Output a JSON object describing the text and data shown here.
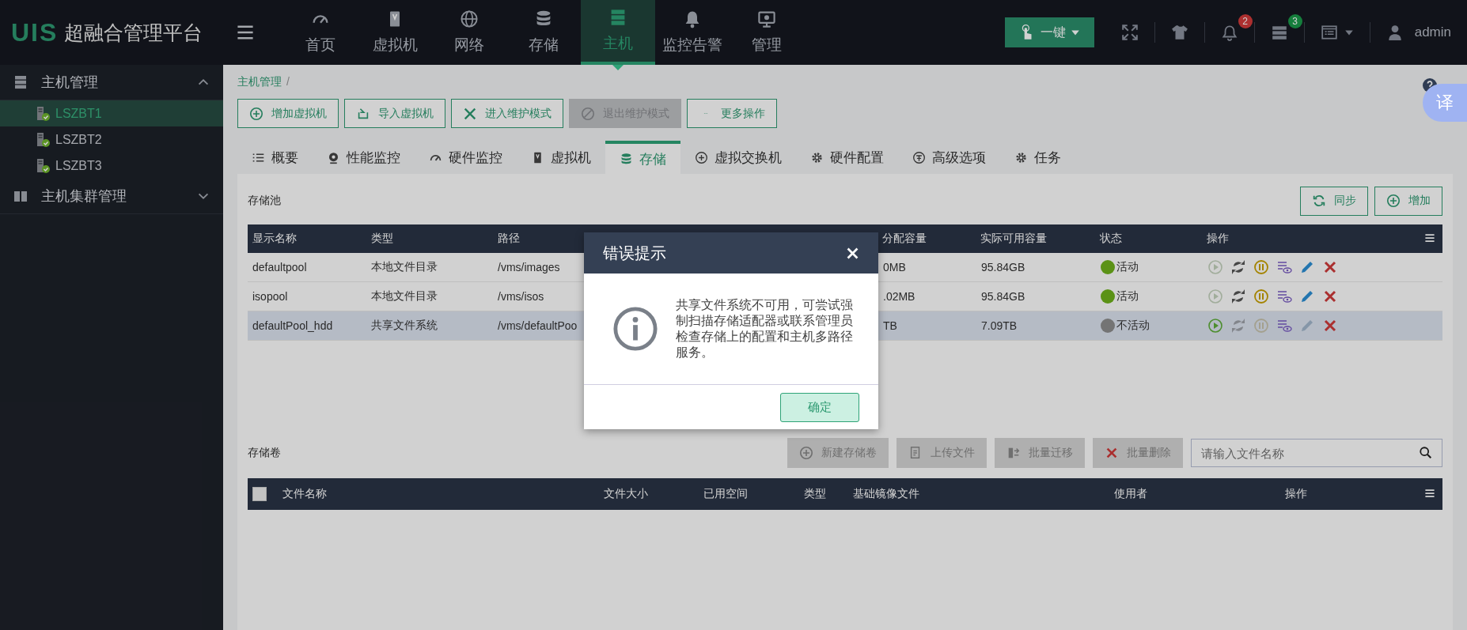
{
  "logo": {
    "mark": "UIS",
    "name": "超融合管理平台"
  },
  "nav": [
    {
      "label": "首页",
      "selected": false
    },
    {
      "label": "虚拟机",
      "selected": false
    },
    {
      "label": "网络",
      "selected": false
    },
    {
      "label": "存储",
      "selected": false
    },
    {
      "label": "主机",
      "selected": true
    },
    {
      "label": "监控告警",
      "selected": false
    },
    {
      "label": "管理",
      "selected": false
    }
  ],
  "topbar": {
    "quick_button": "一键",
    "alerts_badge": "2",
    "tasks_badge": "3",
    "user": "admin"
  },
  "sidebar": [
    {
      "label": "主机管理",
      "expanded": true,
      "children": [
        {
          "label": "LSZBT1",
          "selected": true
        },
        {
          "label": "LSZBT2",
          "selected": false
        },
        {
          "label": "LSZBT3",
          "selected": false
        }
      ]
    },
    {
      "label": "主机集群管理",
      "expanded": false
    }
  ],
  "breadcrumb": {
    "items": [
      "主机管理"
    ],
    "separator": "/"
  },
  "actions": [
    {
      "label": "增加虚拟机",
      "disabled": false
    },
    {
      "label": "导入虚拟机",
      "disabled": false
    },
    {
      "label": "进入维护模式",
      "disabled": false
    },
    {
      "label": "退出维护模式",
      "disabled": true
    },
    {
      "label": "更多操作",
      "disabled": false
    }
  ],
  "tabs": [
    {
      "label": "概要",
      "selected": false
    },
    {
      "label": "性能监控",
      "selected": false
    },
    {
      "label": "硬件监控",
      "selected": false
    },
    {
      "label": "虚拟机",
      "selected": false
    },
    {
      "label": "存储",
      "selected": true
    },
    {
      "label": "虚拟交换机",
      "selected": false
    },
    {
      "label": "硬件配置",
      "selected": false
    },
    {
      "label": "高级选项",
      "selected": false
    },
    {
      "label": "任务",
      "selected": false
    }
  ],
  "pool": {
    "title": "存储池",
    "buttons": [
      "同步",
      "增加"
    ],
    "columns": [
      "显示名称",
      "类型",
      "路径",
      "分配容量",
      "实际可用容量",
      "状态",
      "操作"
    ],
    "rows": [
      {
        "name": "defaultpool",
        "type": "本地文件目录",
        "path": "/vms/images",
        "allocated": "0MB",
        "available": "95.84GB",
        "status": "活动",
        "active": true,
        "selected": false,
        "actions": [
          {
            "kind": "start",
            "disabled": true
          },
          {
            "kind": "sync",
            "disabled": false
          },
          {
            "kind": "pause",
            "disabled": false
          },
          {
            "kind": "view",
            "disabled": false
          },
          {
            "kind": "edit",
            "disabled": false
          },
          {
            "kind": "delete",
            "disabled": false
          }
        ]
      },
      {
        "name": "isopool",
        "type": "本地文件目录",
        "path": "/vms/isos",
        "allocated": ".02MB",
        "available": "95.84GB",
        "status": "活动",
        "active": true,
        "selected": false,
        "actions": [
          {
            "kind": "start",
            "disabled": true
          },
          {
            "kind": "sync",
            "disabled": false
          },
          {
            "kind": "pause",
            "disabled": false
          },
          {
            "kind": "view",
            "disabled": false
          },
          {
            "kind": "edit",
            "disabled": false
          },
          {
            "kind": "delete",
            "disabled": false
          }
        ]
      },
      {
        "name": "defaultPool_hdd",
        "type": "共享文件系统",
        "path": "/vms/defaultPoo",
        "allocated": "TB",
        "available": "7.09TB",
        "status": "不活动",
        "active": false,
        "selected": true,
        "actions": [
          {
            "kind": "start",
            "disabled": false
          },
          {
            "kind": "sync",
            "disabled": true
          },
          {
            "kind": "pause",
            "disabled": true
          },
          {
            "kind": "view",
            "disabled": false
          },
          {
            "kind": "edit",
            "disabled": true
          },
          {
            "kind": "delete",
            "disabled": false
          }
        ]
      }
    ]
  },
  "volumes": {
    "title": "存储卷",
    "buttons": [
      {
        "label": "新建存储卷",
        "disabled": true
      },
      {
        "label": "上传文件",
        "disabled": true
      },
      {
        "label": "批量迁移",
        "disabled": true
      },
      {
        "label": "批量删除",
        "disabled": true
      }
    ],
    "search": {
      "placeholder": "请输入文件名称"
    },
    "select_all": {
      "checked": false
    },
    "columns": [
      "文件名称",
      "文件大小",
      "已用空间",
      "类型",
      "基础镜像文件",
      "使用者",
      "操作"
    ]
  },
  "translate_button": "译",
  "dialog": {
    "title": "错误提示",
    "message": "共享文件系统不可用，可尝试强制扫描存储适配器或联系管理员检查存储上的配置和主机多路径服务。",
    "confirm": "确定"
  }
}
